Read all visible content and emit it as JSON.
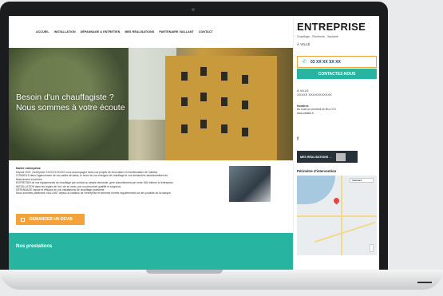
{
  "nav": {
    "items": [
      "ACCUEIL",
      "INSTALLATION",
      "DÉPANNAGE & ENTRETIEN",
      "MES RÉALISATIONS",
      "PARTENAIRE VAILLANT",
      "CONTACT"
    ]
  },
  "hero": {
    "line1": "Besoin d'un chauffagiste ?",
    "line2": "Nous sommes à votre écoute"
  },
  "about": {
    "title": "Notre entreprise",
    "lines": [
      "Depuis 2007, l'entreprise XXXXXXXXXXX vous accompagne dans vos projets de rénovation et d'amélioration de l'habitat.",
      "CONSEILS dans l'agencement de vos salles de bains, le choix de vos énergies de chauffage et vos démarches administratives de",
      "financement et primes.",
      "ENTRETIEN de vos équipements de chauffage par contrat ou simple demande, géré annuellement par notre SAV interne à l'entreprise.",
      "INSTALLATION dans les règles de l'art, clé en main, par un personnel qualifié et soigneux.",
      "DÉPANNAGE rapide et efficace de vos installations de chauffage plomberie.",
      "Nous sommes partenaire VAILLANT depuis la création de l'entreprise et sommes formés régulièrement sur les produits de la marque."
    ]
  },
  "cta": {
    "label": "DEMANDER UN DEVIS",
    "icon": "document-icon"
  },
  "services": {
    "title": "Nos prestations"
  },
  "sidebar": {
    "brand": "ENTREPRISE",
    "tagline": "Chauffage - Plomberie - Sanitaire",
    "city": "À VILLE",
    "phone": "03 XX XX XX XX",
    "contact_label": "CONTACTEZ-NOUS",
    "address_city": "À VILLE",
    "address_line": "XXXXX XXXXXXXXXXX",
    "hours_title": "Horaires",
    "hours_text": "Du lundi au vendredi de 8h à 17h",
    "website": "www.vaillant.fr",
    "facebook": "f",
    "realisations_label": "MES RÉALISATIONS →",
    "zone_title": "Périmètre d'intervention",
    "map_type": "Standard"
  },
  "colors": {
    "teal": "#27b4a0",
    "orange": "#f3a33a",
    "navy": "#1d3d78"
  }
}
